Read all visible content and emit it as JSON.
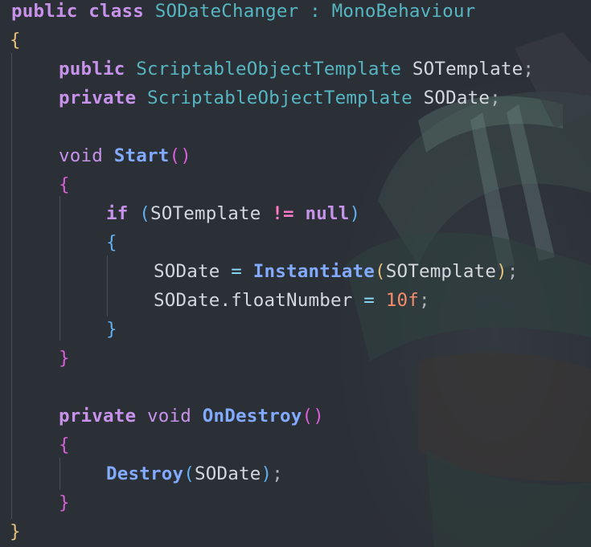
{
  "code": {
    "l1": {
      "kw1": "public",
      "kw2": "class",
      "name": "SODateChanger",
      "colon": ":",
      "base": "MonoBehaviour"
    },
    "l2": {
      "brace": "{"
    },
    "l3": {
      "kw": "public",
      "type": "ScriptableObjectTemplate",
      "name": "SOTemplate",
      "semi": ";"
    },
    "l4": {
      "kw": "private",
      "type": "ScriptableObjectTemplate",
      "name": "SODate",
      "semi": ";"
    },
    "l6": {
      "kw": "void",
      "fn": "Start",
      "paren": "()"
    },
    "l7": {
      "brace": "{"
    },
    "l8": {
      "kw": "if",
      "lp": "(",
      "name": "SOTemplate",
      "op": "!=",
      "null": "null",
      "rp": ")"
    },
    "l9": {
      "brace": "{"
    },
    "l10": {
      "lhs": "SODate",
      "eq": "=",
      "fn": "Instantiate",
      "lp": "(",
      "arg": "SOTemplate",
      "rp": ")",
      "semi": ";"
    },
    "l11": {
      "obj": "SODate",
      "dot": ".",
      "field": "floatNumber",
      "eq": "=",
      "num": "10f",
      "semi": ";"
    },
    "l12": {
      "brace": "}"
    },
    "l13": {
      "brace": "}"
    },
    "l15": {
      "kw1": "private",
      "kw2": "void",
      "fn": "OnDestroy",
      "paren": "()"
    },
    "l16": {
      "brace": "{"
    },
    "l17": {
      "fn": "Destroy",
      "lp": "(",
      "arg": "SODate",
      "rp": ")",
      "semi": ";"
    },
    "l18": {
      "brace": "}"
    },
    "l19": {
      "brace": "}"
    }
  },
  "colors": {
    "background": "#2b2f36",
    "keyword": "#c792ea",
    "type": "#56b6c2",
    "function": "#82aaff",
    "number": "#f78c6c"
  }
}
